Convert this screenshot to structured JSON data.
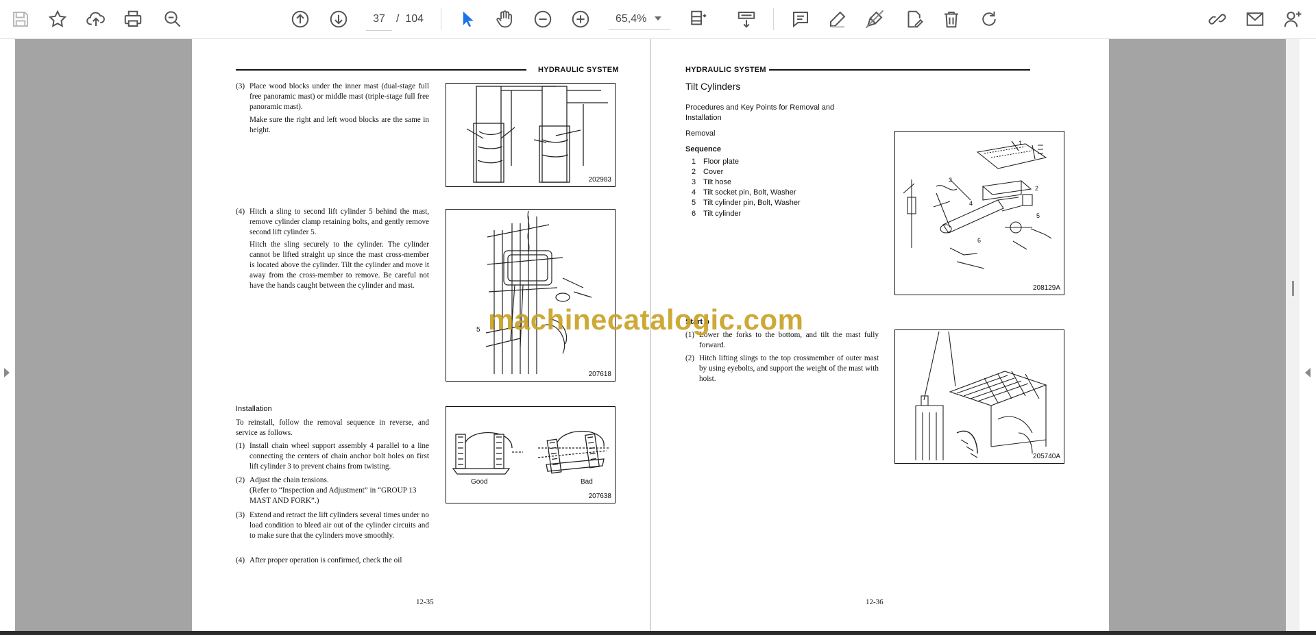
{
  "toolbar": {
    "page_current": "37",
    "page_separator": "/",
    "page_total": "104",
    "zoom": "65,4%"
  },
  "left_page": {
    "header": "HYDRAULIC SYSTEM",
    "step3_num": "(3)",
    "step3_text": "Place wood blocks under the inner mast (dual-stage full free panoramic mast) or middle mast (triple-stage full free panoramic mast).",
    "step3_note": "Make sure the right and left wood blocks are the same in height.",
    "fig1_code": "202983",
    "step4_num": "(4)",
    "step4_text": "Hitch a sling to second lift cylinder 5 behind the mast, remove cylinder clamp retaining bolts, and gently remove second lift cylinder 5.",
    "step4_note": "Hitch the sling securely to the cylinder. The cylinder cannot be lifted straight up since the mast cross-member is located above the cylinder. Tilt the cylinder and move it away from the cross-member to remove. Be careful not have the hands caught between the cylinder and mast.",
    "fig2_code": "207618",
    "fig2_label": "5",
    "install_title": "Installation",
    "install_intro": "To reinstall, follow the removal sequence in reverse, and service as follows.",
    "inst1_num": "(1)",
    "inst1_text": "Install chain wheel support assembly 4 parallel to a line connecting the centers of chain anchor bolt holes on first lift cylinder 3 to prevent chains from twisting.",
    "inst2_num": "(2)",
    "inst2_text": "Adjust the chain tensions.",
    "inst2_ref": "(Refer to “Inspection and Adjustment” in “GROUP 13 MAST AND FORK”.)",
    "inst3_num": "(3)",
    "inst3_text": "Extend and retract the lift cylinders several times under no load condition to bleed air out of the cylinder circuits and to make sure that the cylinders move smoothly.",
    "inst4_num": "(4)",
    "inst4_text": "After proper operation is confirmed, check the oil",
    "fig3_good": "Good",
    "fig3_bad": "Bad",
    "fig3_code": "207638",
    "page_number": "12-35"
  },
  "right_page": {
    "header": "HYDRAULIC SYSTEM",
    "title": "Tilt Cylinders",
    "subtitle": "Procedures and Key Points for Removal and Installation",
    "removal": "Removal",
    "sequence": "Sequence",
    "seq": [
      {
        "n": "1",
        "t": "Floor plate"
      },
      {
        "n": "2",
        "t": "Cover"
      },
      {
        "n": "3",
        "t": "Tilt hose"
      },
      {
        "n": "4",
        "t": "Tilt socket pin, Bolt, Washer"
      },
      {
        "n": "5",
        "t": "Tilt cylinder pin, Bolt, Washer"
      },
      {
        "n": "6",
        "t": "Tilt cylinder"
      }
    ],
    "fig1_code": "208129A",
    "start_label": "Start b",
    "step1_num": "(1)",
    "step1_text": "Lower the forks to the bottom, and tilt the mast fully forward.",
    "step2_num": "(2)",
    "step2_text": "Hitch lifting slings to the top crossmember of outer mast by using eyebolts, and support the weight of the mast with hoist.",
    "fig2_code": "205740A",
    "page_number": "12-36"
  },
  "watermark": "machinecatalogic.com"
}
